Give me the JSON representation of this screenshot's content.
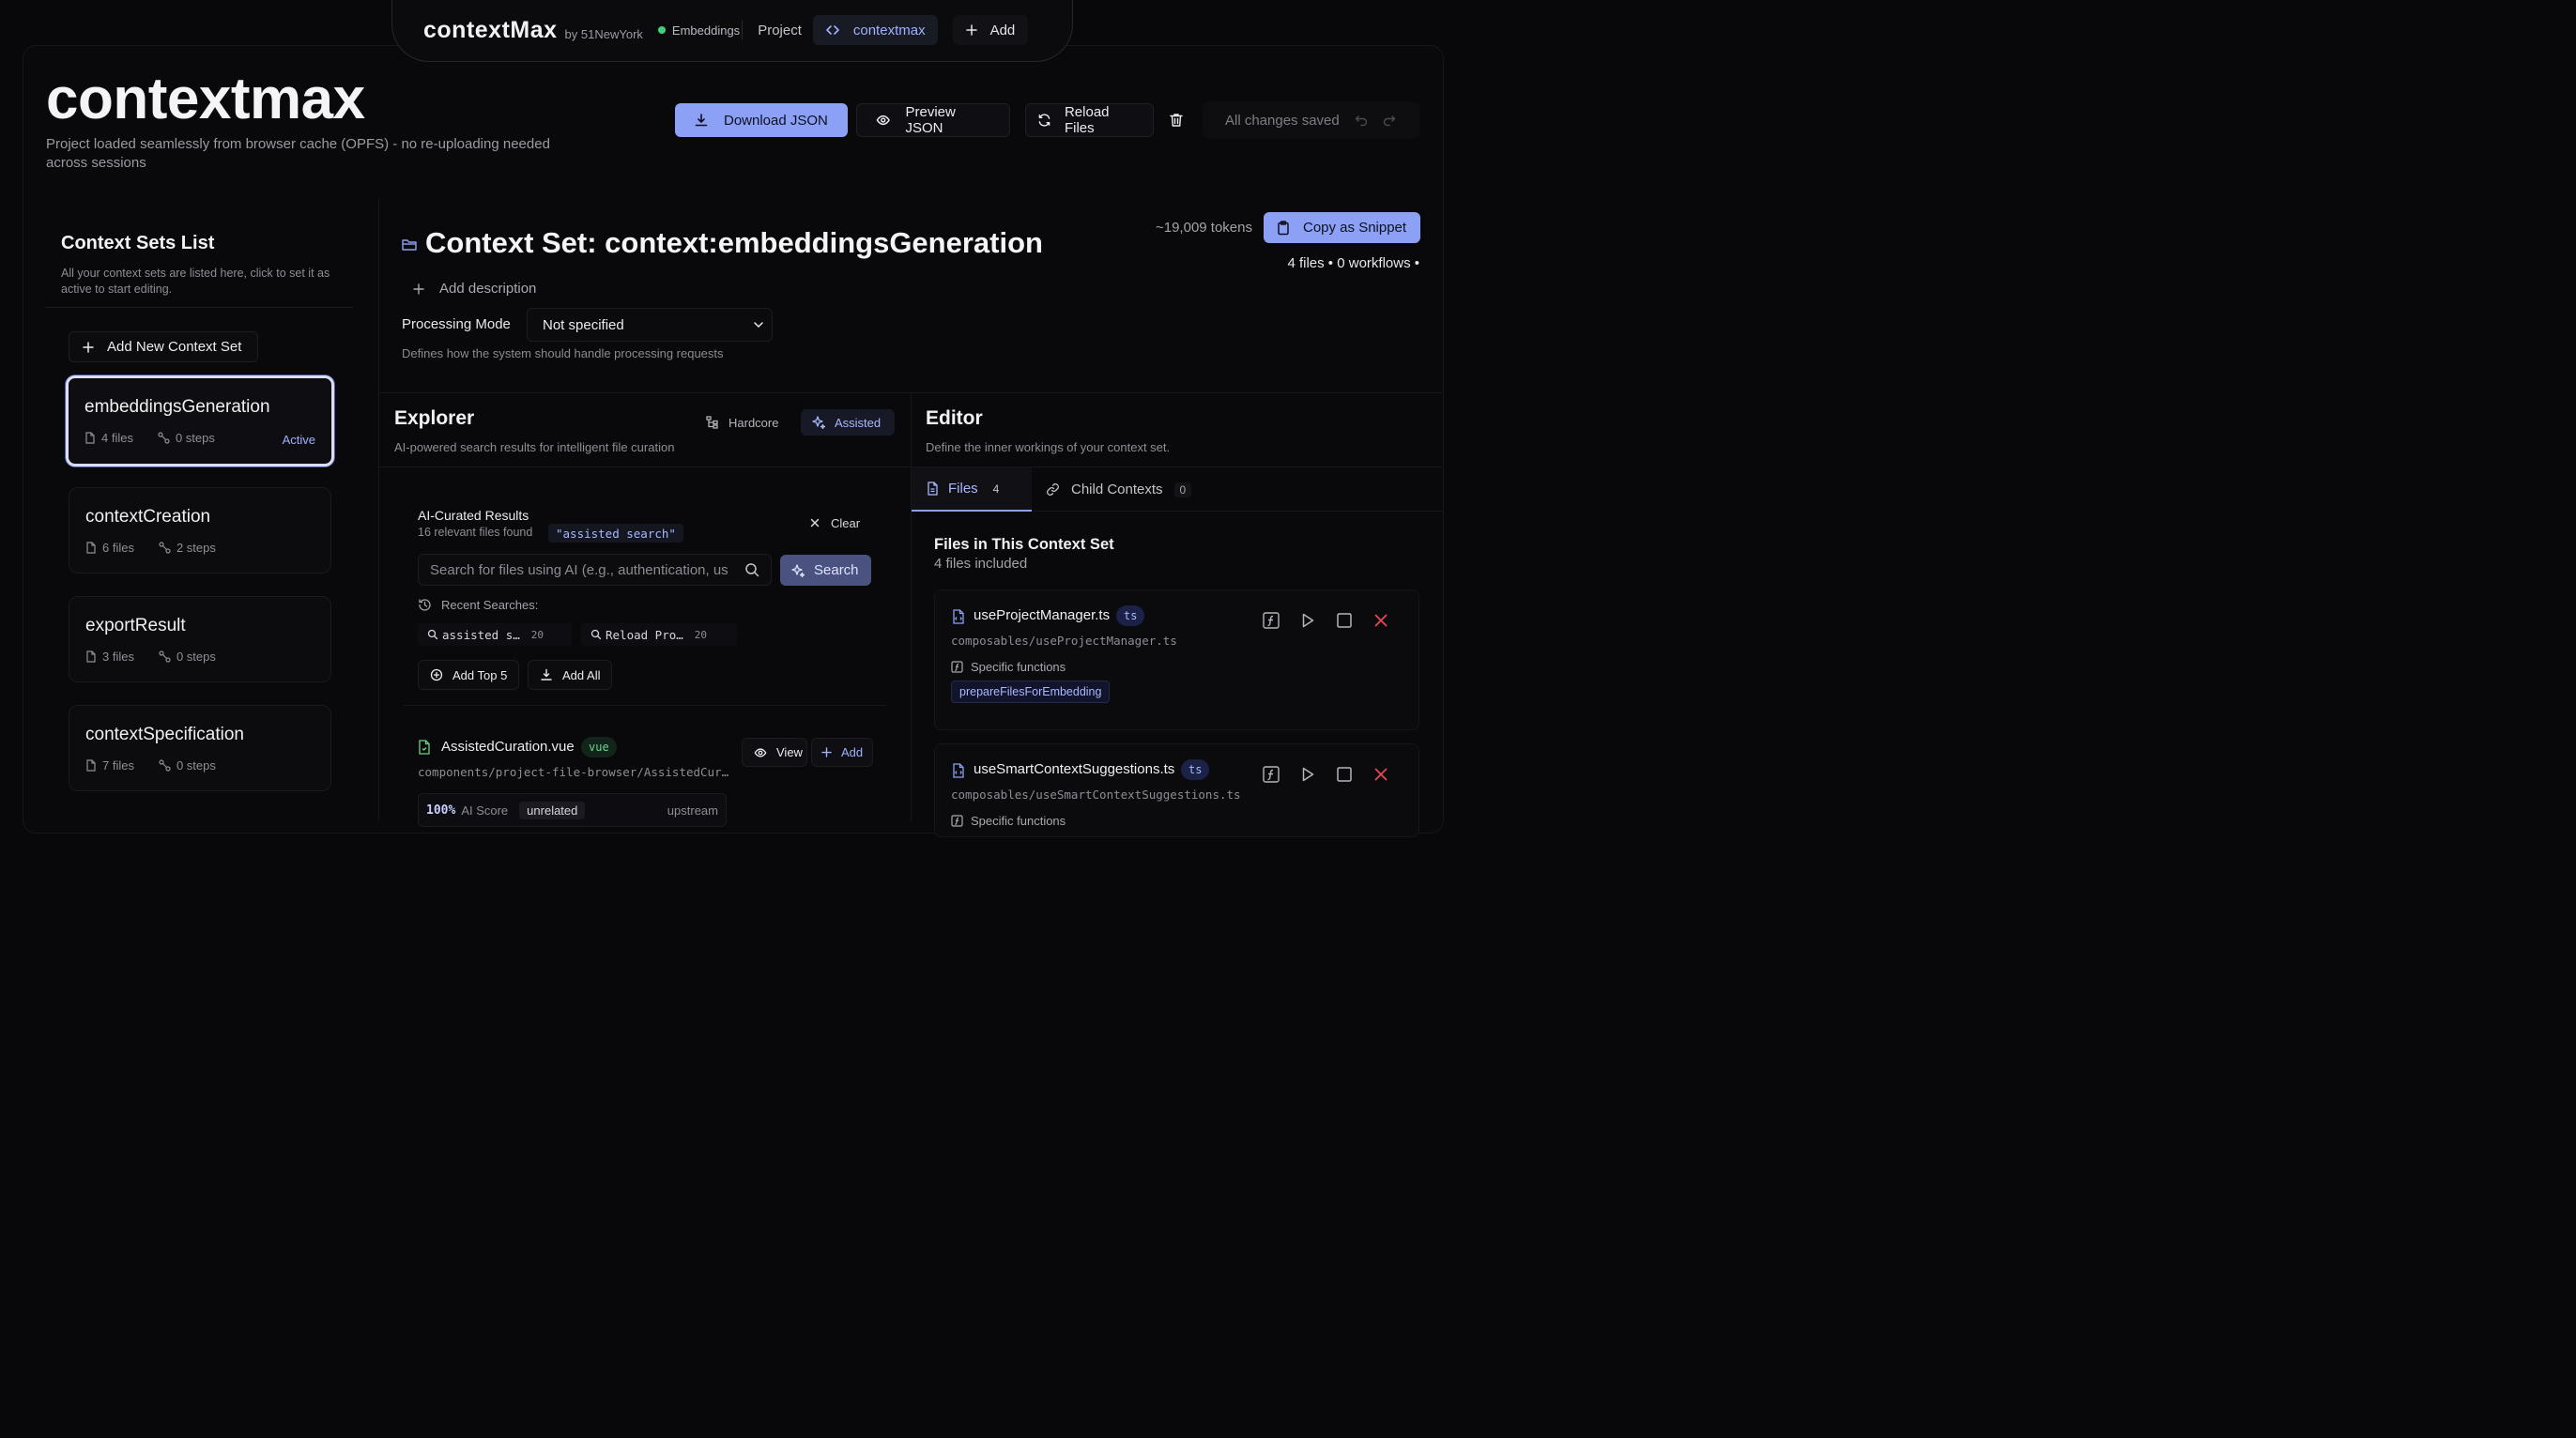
{
  "topnav": {
    "brand": "contextMax",
    "by": "by 51NewYork",
    "status": "Embeddings",
    "project": "Project",
    "current": "contextmax",
    "add": "Add"
  },
  "header": {
    "title": "contextmax",
    "subtitle": "Project loaded seamlessly from browser cache (OPFS) - no re-uploading needed across sessions",
    "download": "Download JSON",
    "preview": "Preview JSON",
    "reload": "Reload Files",
    "saved": "All changes saved"
  },
  "sidebar": {
    "title": "Context Sets List",
    "description": "All your context sets are listed here, click to set it as active to start editing.",
    "add_label": "Add New Context Set",
    "active_label": "Active",
    "sets": [
      {
        "name": "embeddingsGeneration",
        "files": "4 files",
        "steps": "0 steps"
      },
      {
        "name": "contextCreation",
        "files": "6 files",
        "steps": "2 steps"
      },
      {
        "name": "exportResult",
        "files": "3 files",
        "steps": "0 steps"
      },
      {
        "name": "contextSpecification",
        "files": "7 files",
        "steps": "0 steps"
      }
    ]
  },
  "context_set": {
    "title": "Context Set: context:embeddingsGeneration",
    "tokens": "~19,009 tokens",
    "copy": "Copy as Snippet",
    "summary": "4 files • 0 workflows •",
    "add_description": "Add description",
    "processing_label": "Processing Mode",
    "processing_value": "Not specified",
    "processing_hint": "Defines how the system should handle processing requests"
  },
  "explorer": {
    "title": "Explorer",
    "subtitle": "AI-powered search results for intelligent file curation",
    "hardcore": "Hardcore",
    "assisted": "Assisted",
    "results_title": "AI-Curated Results",
    "results_count": "16 relevant files found",
    "results_tag": "\"assisted search\"",
    "clear": "Clear",
    "search_placeholder": "Search for files using AI (e.g., authentication, us",
    "search_button": "Search",
    "recent_label": "Recent Searches:",
    "recent": [
      {
        "text": "assisted s…",
        "count": "20"
      },
      {
        "text": "Reload Pro…",
        "count": "20"
      }
    ],
    "add_top": "Add Top 5",
    "add_all": "Add All",
    "file": {
      "name": "AssistedCuration.vue",
      "ext": "vue",
      "path": "components/project-file-browser/AssistedCur…",
      "view": "View",
      "add": "Add",
      "score": "100%",
      "score_label": "AI Score",
      "relation": "unrelated",
      "direction": "upstream"
    }
  },
  "editor": {
    "title": "Editor",
    "subtitle": "Define the inner workings of your context set.",
    "tab_files": "Files",
    "tab_files_count": "4",
    "tab_child": "Child Contexts",
    "tab_child_count": "0",
    "files_title": "Files in This Context Set",
    "files_sub": "4 files included",
    "files": [
      {
        "name": "useProjectManager.ts",
        "ext": "ts",
        "path": "composables/useProjectManager.ts",
        "specific": "Specific functions",
        "function": "prepareFilesForEmbedding"
      },
      {
        "name": "useSmartContextSuggestions.ts",
        "ext": "ts",
        "path": "composables/useSmartContextSuggestions.ts",
        "specific": "Specific functions"
      }
    ]
  },
  "colors": {
    "accent": "#8ca0f5",
    "background": "#08080a",
    "success": "#3fd07a",
    "danger": "#e5484d"
  }
}
